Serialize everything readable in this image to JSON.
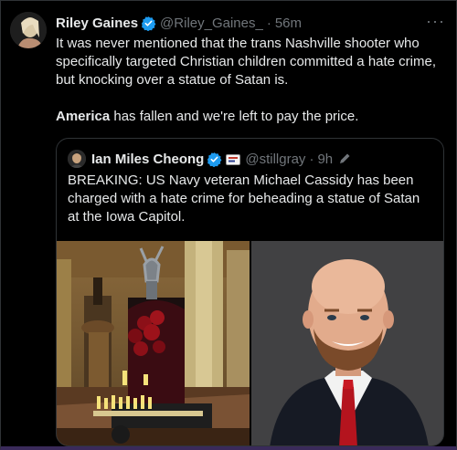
{
  "tweet": {
    "author_name": "Riley Gaines",
    "author_handle": "@Riley_Gaines_",
    "separator": "·",
    "time": "56m",
    "more_label": "···",
    "paragraph1": "It was never mentioned that the trans Nashville shooter who specifically targeted Christian children committed a hate crime, but knocking over a statue of Satan is.",
    "paragraph2_bold": "America",
    "paragraph2_rest": " has fallen and we're left to pay the price.",
    "verified_color": "#1d9bf0"
  },
  "quote": {
    "author_name": "Ian Miles Cheong",
    "author_handle": "@stillgray",
    "separator": "·",
    "time": "9h",
    "text": "BREAKING: US Navy veteran Michael Cassidy has been charged with a hate crime for beheading a statue of Satan at the Iowa Capitol.",
    "icons": [
      "verified-icon",
      "affiliate-badge-icon",
      "edit-pencil-icon"
    ]
  },
  "media": [
    {
      "name": "satan-statue-photo",
      "icon": "photo"
    },
    {
      "name": "man-portrait-photo",
      "icon": "photo"
    }
  ]
}
